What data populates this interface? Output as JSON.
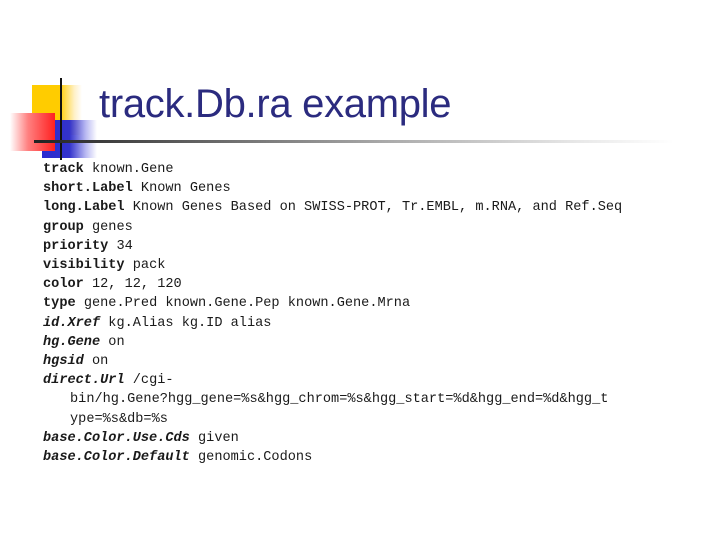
{
  "slide": {
    "title": "track.Db.ra example",
    "lines": [
      {
        "key": "track",
        "value": "known.Gene",
        "italic": false
      },
      {
        "key": "short.Label",
        "value": "Known Genes",
        "italic": false
      },
      {
        "key": "long.Label",
        "value": "Known Genes Based on SWISS-PROT, Tr.EMBL, m.RNA, and Ref.Seq",
        "italic": false
      },
      {
        "key": "group",
        "value": "genes",
        "italic": false
      },
      {
        "key": "priority",
        "value": "34",
        "italic": false
      },
      {
        "key": "visibility",
        "value": "pack",
        "italic": false
      },
      {
        "key": "color",
        "value": "12, 12, 120",
        "italic": false
      },
      {
        "key": "type",
        "value": "gene.Pred known.Gene.Pep known.Gene.Mrna",
        "italic": false
      },
      {
        "key": "id.Xref",
        "value": "kg.Alias kg.ID alias",
        "italic": true
      },
      {
        "key": "hg.Gene",
        "value": "on",
        "italic": true
      },
      {
        "key": "hgsid",
        "value": "on",
        "italic": true
      },
      {
        "key": "direct.Url",
        "value": "/cgi-",
        "italic": true
      },
      {
        "key": "",
        "value": "bin/hg.Gene?hgg_gene=%s&hgg_chrom=%s&hgg_start=%d&hgg_end=%d&hgg_t",
        "continuation": true
      },
      {
        "key": "",
        "value": "ype=%s&db=%s",
        "continuation": true
      },
      {
        "key": "base.Color.Use.Cds",
        "value": "given",
        "italic": true
      },
      {
        "key": "base.Color.Default",
        "value": "genomic.Codons",
        "italic": true
      }
    ]
  },
  "colors": {
    "title": "#2b2b7f",
    "yellow": "#ffcc00",
    "red": "#ff2020",
    "blue": "#3333cc"
  }
}
